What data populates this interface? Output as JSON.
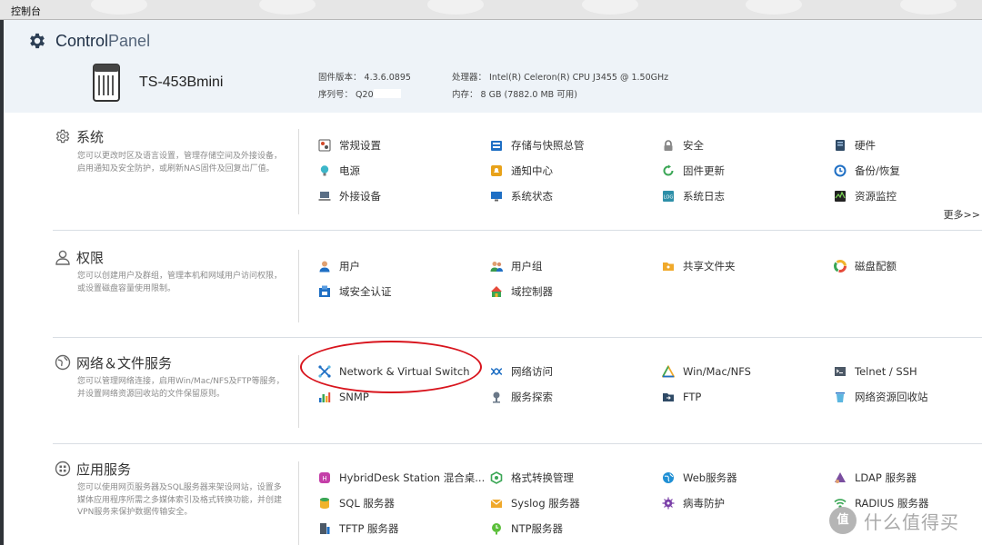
{
  "window": {
    "title": "控制台"
  },
  "header": {
    "app_title_a": "Control",
    "app_title_b": "Panel",
    "device_name": "TS-453Bmini",
    "firmware_label": "固件版本：",
    "firmware_value": "4.3.6.0895",
    "serial_label": "序列号：",
    "serial_value": "Q20",
    "cpu_label": "处理器：",
    "cpu_value": "Intel(R) Celeron(R) CPU J3455 @ 1.50GHz",
    "memory_label": "内存：",
    "memory_value": "8 GB (7882.0 MB 可用)"
  },
  "sections": {
    "system": {
      "title": "系统",
      "desc": "您可以更改时区及语言设置，管理存储空间及外接设备，启用通知及安全防护，或刷新NAS固件及回复出厂值。",
      "items": [
        {
          "label": "常规设置",
          "icon": "general-settings-icon"
        },
        {
          "label": "存储与快照总管",
          "icon": "storage-icon"
        },
        {
          "label": "安全",
          "icon": "lock-icon"
        },
        {
          "label": "硬件",
          "icon": "hardware-icon"
        },
        {
          "label": "电源",
          "icon": "bulb-icon"
        },
        {
          "label": "通知中心",
          "icon": "notification-icon"
        },
        {
          "label": "固件更新",
          "icon": "update-icon"
        },
        {
          "label": "备份/恢复",
          "icon": "backup-icon"
        },
        {
          "label": "外接设备",
          "icon": "laptop-icon"
        },
        {
          "label": "系统状态",
          "icon": "monitor-icon"
        },
        {
          "label": "系统日志",
          "icon": "log-icon"
        },
        {
          "label": "资源监控",
          "icon": "resource-monitor-icon"
        }
      ],
      "more": "更多>>"
    },
    "privilege": {
      "title": "权限",
      "desc": "您可以创建用户及群组，管理本机和网域用户访问权限，或设置磁盘容量使用限制。",
      "items": [
        {
          "label": "用户",
          "icon": "user-icon"
        },
        {
          "label": "用户组",
          "icon": "user-group-icon"
        },
        {
          "label": "共享文件夹",
          "icon": "shared-folder-icon"
        },
        {
          "label": "磁盘配额",
          "icon": "quota-icon"
        },
        {
          "label": "域安全认证",
          "icon": "domain-security-icon"
        },
        {
          "label": "域控制器",
          "icon": "domain-controller-icon"
        }
      ]
    },
    "network": {
      "title": "网络＆文件服务",
      "desc": "您可以管理网络连接，启用Win/Mac/NFS及FTP等服务，并设置网络资源回收站的文件保留原则。",
      "items": [
        {
          "label": "Network & Virtual Switch",
          "icon": "network-switch-icon"
        },
        {
          "label": "网络访问",
          "icon": "network-access-icon"
        },
        {
          "label": "Win/Mac/NFS",
          "icon": "triangle-icon"
        },
        {
          "label": "Telnet / SSH",
          "icon": "terminal-icon"
        },
        {
          "label": "SNMP",
          "icon": "bar-chart-icon"
        },
        {
          "label": "服务探索",
          "icon": "service-discovery-icon"
        },
        {
          "label": "FTP",
          "icon": "ftp-icon"
        },
        {
          "label": "网络资源回收站",
          "icon": "recycle-bin-icon"
        }
      ]
    },
    "apps": {
      "title": "应用服务",
      "desc": "您可以使用网页服务器及SQL服务器来架设网站，设置多媒体应用程序所需之多媒体索引及格式转换功能，并创建VPN服务来保护数据传输安全。",
      "items": [
        {
          "label": "HybridDesk Station 混合桌...",
          "icon": "hybriddesk-icon"
        },
        {
          "label": "格式转换管理",
          "icon": "transcode-icon"
        },
        {
          "label": "Web服务器",
          "icon": "web-server-icon"
        },
        {
          "label": "LDAP 服务器",
          "icon": "ldap-icon"
        },
        {
          "label": "SQL 服务器",
          "icon": "sql-icon"
        },
        {
          "label": "Syslog 服务器",
          "icon": "syslog-icon"
        },
        {
          "label": "病毒防护",
          "icon": "antivirus-icon"
        },
        {
          "label": "RADIUS 服务器",
          "icon": "radius-icon"
        },
        {
          "label": "TFTP 服务器",
          "icon": "tftp-icon"
        },
        {
          "label": "NTP服务器",
          "icon": "ntp-icon"
        }
      ]
    }
  },
  "watermark": {
    "badge": "值",
    "text": "什么值得买"
  },
  "colors": {
    "annotation": "#d8141d",
    "header_bg": "#eef3f8"
  }
}
